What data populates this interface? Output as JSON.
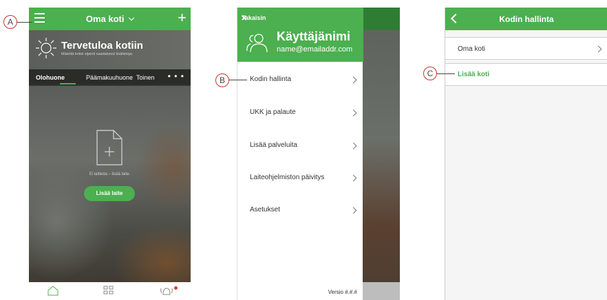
{
  "screen1": {
    "header": {
      "title": "Oma koti",
      "add_icon": "+"
    },
    "welcome": {
      "title": "Tervetuloa kotiin",
      "subtitle": "Määritä kotisi sijainti saadaksesi lisätietoja."
    },
    "tabs": [
      {
        "label": "Olohuone",
        "active": true
      },
      {
        "label": "Päämakuuhuone",
        "active": false
      },
      {
        "label": "Toinen",
        "active": false
      }
    ],
    "more_label": "• • •",
    "empty_text": "Ei laitteita – lisää laite.",
    "add_device_label": "Lisää laite",
    "bottom_nav": [
      "home-icon",
      "grid-icon",
      "alarm-bell-icon"
    ]
  },
  "screen2": {
    "back_label": "Takaisin",
    "user_name": "Käyttäjänimi",
    "email": "name@emailaddr.com",
    "menu": [
      "Kodin hallinta",
      "UKK ja palaute",
      "Lisää palveluita",
      "Laiteohjelmiston päivitys",
      "Asetukset"
    ],
    "version": "Versio #.#.#"
  },
  "screen3": {
    "title": "Kodin hallinta",
    "home_row": "Oma koti",
    "add_home": "Lisää koti"
  },
  "callouts": {
    "a": "A",
    "b": "B",
    "c": "C"
  },
  "colors": {
    "accent": "#4caf50",
    "callout_border": "#c0392b",
    "badge": "#e53935"
  }
}
